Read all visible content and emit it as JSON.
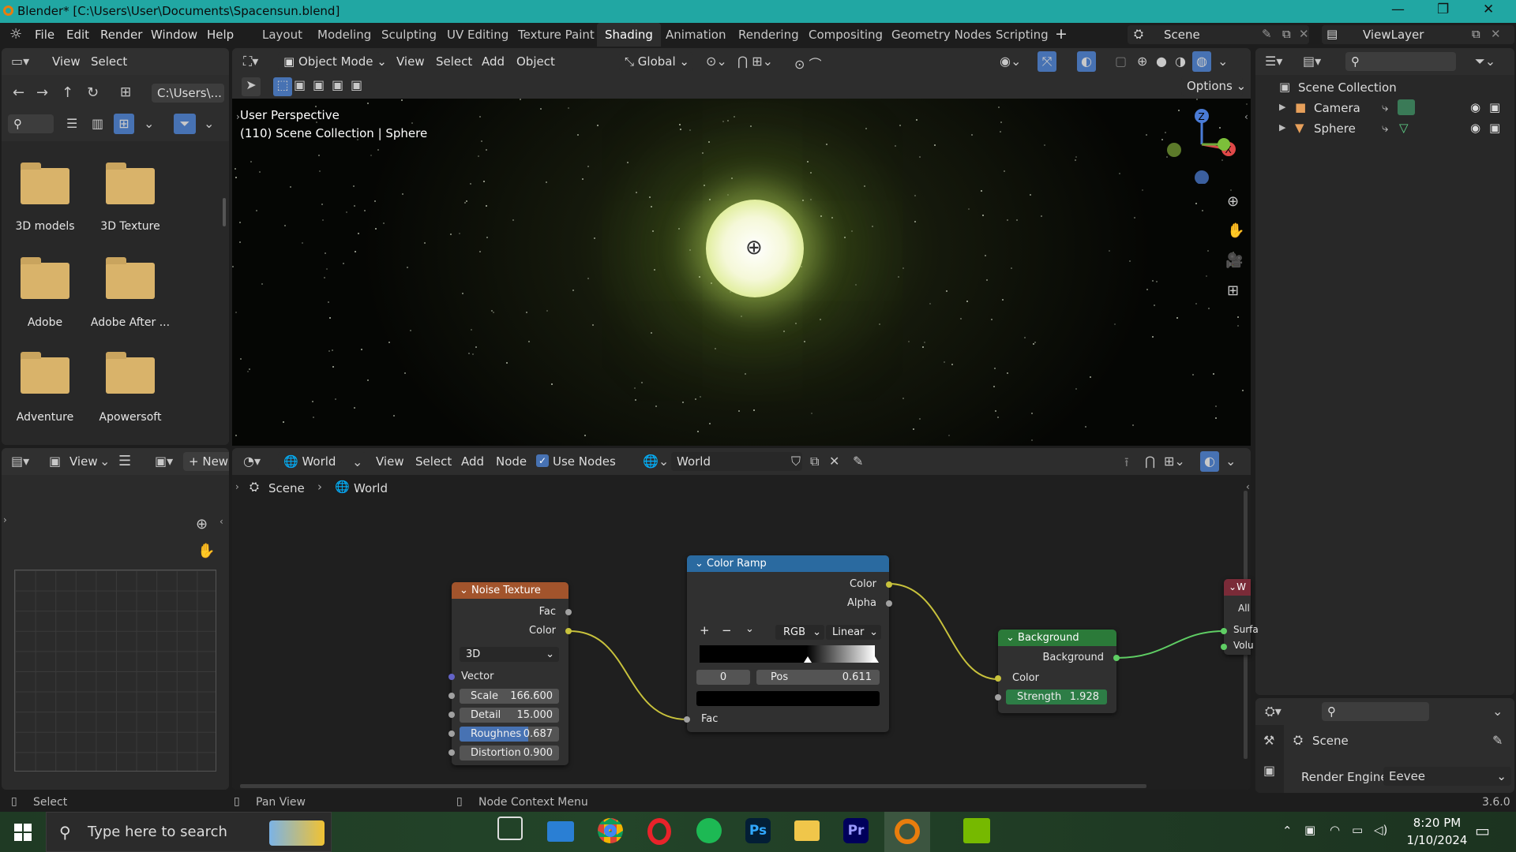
{
  "title_bar": {
    "title": "Blender* [C:\\Users\\User\\Documents\\Spacensun.blend]"
  },
  "menu": {
    "items": [
      "File",
      "Edit",
      "Render",
      "Window",
      "Help"
    ]
  },
  "workspaces": [
    "Layout",
    "Modeling",
    "Sculpting",
    "UV Editing",
    "Texture Paint",
    "Shading",
    "Animation",
    "Rendering",
    "Compositing",
    "Geometry Nodes",
    "Scripting"
  ],
  "active_workspace": "Shading",
  "scene_selector": {
    "label": "Scene"
  },
  "viewlayer_selector": {
    "label": "ViewLayer"
  },
  "file_browser": {
    "menu": [
      "View",
      "Select"
    ],
    "path": "C:\\Users\\...",
    "folders": [
      "3D models",
      "3D Texture",
      "Adobe",
      "Adobe After ...",
      "Adventure",
      "Apowersoft"
    ]
  },
  "viewport": {
    "mode": "Object Mode",
    "menu": [
      "View",
      "Select",
      "Add",
      "Object"
    ],
    "transform": "Global",
    "options": "Options",
    "info_line1": "User Perspective",
    "info_line2": "(110) Scene Collection | Sphere",
    "gizmo_axis": [
      "Z",
      "X"
    ]
  },
  "outliner": {
    "root": "Scene Collection",
    "items": [
      {
        "name": "Camera"
      },
      {
        "name": "Sphere"
      }
    ]
  },
  "properties": {
    "scene": "Scene",
    "render_engine_label": "Render Engine",
    "render_engine": "Eevee"
  },
  "image_editor": {
    "view": "View",
    "new": "New"
  },
  "node_editor": {
    "type": "World",
    "menu": [
      "View",
      "Select",
      "Add",
      "Node"
    ],
    "use_nodes": "Use Nodes",
    "world_name": "World",
    "breadcrumb": [
      "Scene",
      "World"
    ]
  },
  "nodes": {
    "noise": {
      "title": "Noise Texture",
      "out_fac": "Fac",
      "out_color": "Color",
      "dim": "3D",
      "in_vector": "Vector",
      "fields": [
        {
          "label": "Scale",
          "value": "166.600"
        },
        {
          "label": "Detail",
          "value": "15.000"
        },
        {
          "label": "Roughnes",
          "value": "0.687"
        },
        {
          "label": "Distortion",
          "value": "0.900"
        }
      ]
    },
    "ramp": {
      "title": "Color Ramp",
      "out_color": "Color",
      "out_alpha": "Alpha",
      "mode": "RGB",
      "interp": "Linear",
      "index": "0",
      "pos_label": "Pos",
      "pos_value": "0.611",
      "in_fac": "Fac"
    },
    "background": {
      "title": "Background",
      "out": "Background",
      "in_color": "Color",
      "strength_label": "Strength",
      "strength_value": "1.928"
    },
    "output": {
      "title": "W",
      "target": "All",
      "in_surface": "Surfa",
      "in_volume": "Volu"
    }
  },
  "status_bar": {
    "select": "Select",
    "pan": "Pan View",
    "context": "Node Context Menu",
    "version": "3.6.0"
  },
  "taskbar": {
    "search_placeholder": "Type here to search",
    "time": "8:20 PM",
    "date": "1/10/2024"
  }
}
